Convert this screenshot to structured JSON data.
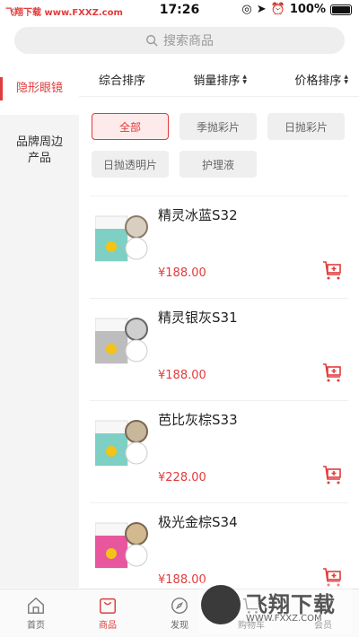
{
  "status": {
    "watermark_left": "飞翔下载 www.FXXZ.com",
    "time": "17:26",
    "battery": "100%"
  },
  "search": {
    "placeholder": "搜索商品"
  },
  "sidebar": {
    "items": [
      {
        "label": "隐形眼镜",
        "active": true
      },
      {
        "label": "品牌周边产品",
        "active": false
      }
    ]
  },
  "sort": {
    "items": [
      {
        "label": "综合排序"
      },
      {
        "label": "销量排序"
      },
      {
        "label": "价格排序"
      }
    ]
  },
  "filters": {
    "chips": [
      {
        "label": "全部",
        "active": true
      },
      {
        "label": "季抛彩片"
      },
      {
        "label": "日抛彩片"
      },
      {
        "label": "日抛透明片"
      },
      {
        "label": "护理液"
      }
    ]
  },
  "products": [
    {
      "name": "精灵冰蓝S32",
      "price": "¥188.00",
      "color": "#7fd0c4"
    },
    {
      "name": "精灵银灰S31",
      "price": "¥188.00",
      "color": "#bdbdbd"
    },
    {
      "name": "芭比灰棕S33",
      "price": "¥228.00",
      "color": "#7fd0c4"
    },
    {
      "name": "极光金棕S34",
      "price": "¥188.00",
      "color": "#e8569e"
    }
  ],
  "tabbar": {
    "items": [
      {
        "label": "首页"
      },
      {
        "label": "商品",
        "active": true
      },
      {
        "label": "发现"
      },
      {
        "label": "购物车"
      },
      {
        "label": "会员"
      }
    ]
  },
  "watermark": {
    "brand": "飞翔下载",
    "url": "WWW.FXXZ.COM"
  },
  "accent": "#e23b3b"
}
